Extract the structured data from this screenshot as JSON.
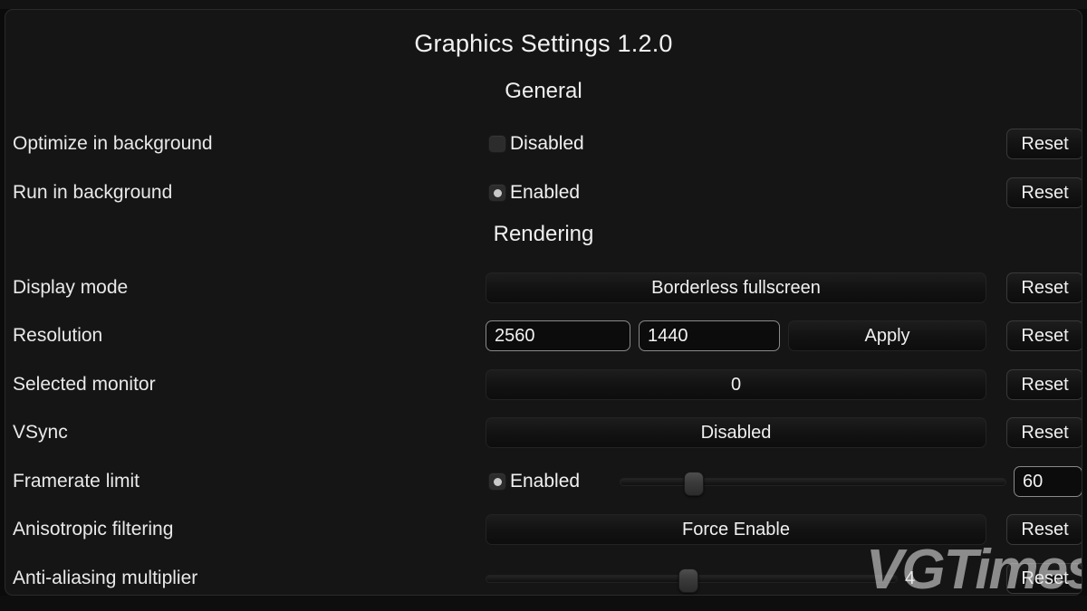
{
  "window": {
    "title": "Graphics Settings 1.2.0"
  },
  "sections": {
    "general": {
      "header": "General",
      "rows": [
        {
          "label": "Optimize in background",
          "control": "checkbox",
          "checked": false,
          "state_text": "Disabled",
          "reset_label": "Reset"
        },
        {
          "label": "Run in background",
          "control": "checkbox",
          "checked": true,
          "state_text": "Enabled",
          "reset_label": "Reset"
        }
      ]
    },
    "rendering": {
      "header": "Rendering",
      "rows": [
        {
          "label": "Display mode",
          "control": "dropdown",
          "value": "Borderless fullscreen",
          "reset_label": "Reset"
        },
        {
          "label": "Resolution",
          "control": "resolution",
          "width_value": "2560",
          "height_value": "1440",
          "apply_label": "Apply",
          "reset_label": "Reset"
        },
        {
          "label": "Selected monitor",
          "control": "dropdown",
          "value": "0",
          "reset_label": "Reset"
        },
        {
          "label": "VSync",
          "control": "dropdown",
          "value": "Disabled",
          "reset_label": "Reset"
        },
        {
          "label": "Framerate limit",
          "control": "checkbox-slider",
          "checked": true,
          "state_text": "Enabled",
          "slider_percent": 19,
          "value": "60"
        },
        {
          "label": "Anisotropic filtering",
          "control": "dropdown",
          "value": "Force Enable",
          "reset_label": "Reset"
        },
        {
          "label": "Anti-aliasing multiplier",
          "control": "slider",
          "slider_percent": 49,
          "value": "4",
          "reset_label": "Reset"
        }
      ]
    }
  },
  "watermark": {
    "text": "VGTimes"
  }
}
